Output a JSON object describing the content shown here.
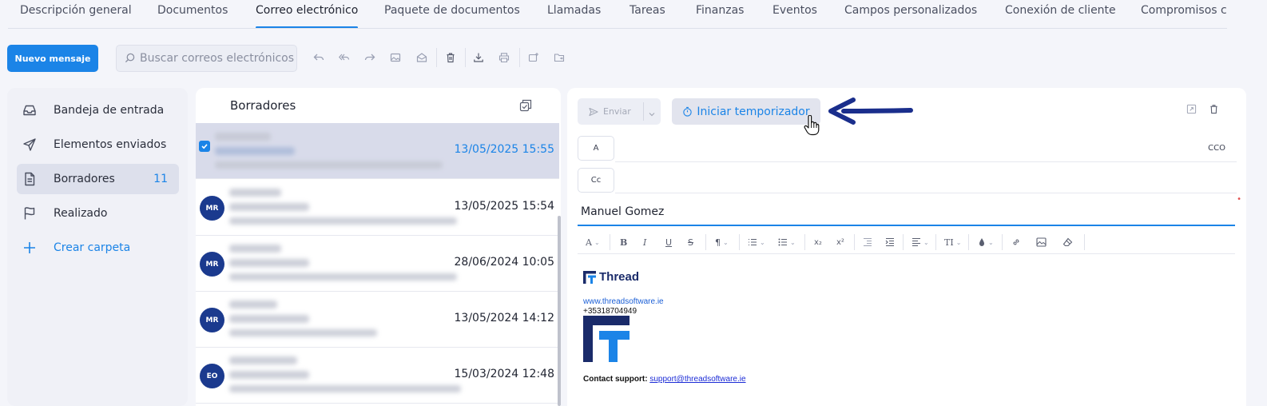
{
  "tabs": [
    {
      "label": "Descripción general"
    },
    {
      "label": "Documentos"
    },
    {
      "label": "Correo electrónico"
    },
    {
      "label": "Paquete de documentos"
    },
    {
      "label": "Llamadas"
    },
    {
      "label": "Tareas"
    },
    {
      "label": "Finanzas"
    },
    {
      "label": "Eventos"
    },
    {
      "label": "Campos personalizados"
    },
    {
      "label": "Conexión de cliente"
    },
    {
      "label": "Compromisos c"
    }
  ],
  "toolbar": {
    "new_message": "Nuevo mensaje",
    "search_placeholder": "Buscar correos electrónicos"
  },
  "nav": [
    {
      "label": "Bandeja de entrada",
      "icon": "inbox-icon"
    },
    {
      "label": "Elementos enviados",
      "icon": "send-icon"
    },
    {
      "label": "Borradores",
      "icon": "draft-file-icon",
      "count": "11"
    },
    {
      "label": "Realizado",
      "icon": "flag-icon"
    },
    {
      "label": "Crear carpeta",
      "icon": "plus-icon"
    }
  ],
  "list": {
    "title": "Borradores",
    "rows": [
      {
        "avatar": "",
        "date": "13/05/2025 15:55",
        "selected": true
      },
      {
        "avatar": "MR",
        "date": "13/05/2025 15:54"
      },
      {
        "avatar": "MR",
        "date": "28/06/2024 10:05"
      },
      {
        "avatar": "MR",
        "date": "13/05/2024 14:12"
      },
      {
        "avatar": "EO",
        "date": "15/03/2024 12:48"
      }
    ]
  },
  "compose": {
    "send_label": "Enviar",
    "timer_label": "Iniciar temporizador",
    "to_label": "A",
    "cc_label": "Cc",
    "bcc_label": "CCO",
    "subject_value": "Manuel Gomez",
    "signature": {
      "brand": "Thread",
      "website": "www.threadsoftware.ie",
      "phone": "+35318704949",
      "support_label": "Contact support:",
      "support_email": "support@threadsoftware.ie"
    }
  },
  "colors": {
    "accent": "#1b84e7",
    "avatar": "#1b3a8e",
    "annotation_arrow": "#1a2e8c"
  }
}
